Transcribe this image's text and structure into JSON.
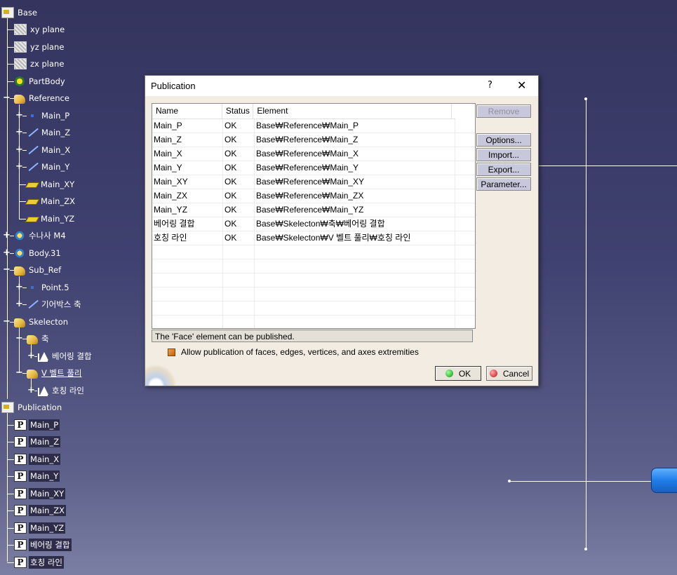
{
  "tree": {
    "root": "Base",
    "items": [
      {
        "label": "xy plane"
      },
      {
        "label": "yz plane"
      },
      {
        "label": "zx plane"
      },
      {
        "label": "PartBody"
      },
      {
        "label": "Reference"
      },
      {
        "label": "Main_P"
      },
      {
        "label": "Main_Z"
      },
      {
        "label": "Main_X"
      },
      {
        "label": "Main_Y"
      },
      {
        "label": "Main_XY"
      },
      {
        "label": "Main_ZX"
      },
      {
        "label": "Main_YZ"
      },
      {
        "label": "수나사 M4"
      },
      {
        "label": "Body.31"
      },
      {
        "label": "Sub_Ref"
      },
      {
        "label": "Point.5"
      },
      {
        "label": "기어박스 축"
      },
      {
        "label": "Skelecton"
      },
      {
        "label": "축"
      },
      {
        "label": "베어링 결합"
      },
      {
        "label": "V 벨트 풀리"
      },
      {
        "label": "호칭 라인"
      },
      {
        "label": "Publication"
      },
      {
        "label": "Main_P"
      },
      {
        "label": "Main_Z"
      },
      {
        "label": "Main_X"
      },
      {
        "label": "Main_Y"
      },
      {
        "label": "Main_XY"
      },
      {
        "label": "Main_ZX"
      },
      {
        "label": "Main_YZ"
      },
      {
        "label": "베어링 결합"
      },
      {
        "label": "호칭 라인"
      }
    ]
  },
  "dialog": {
    "title": "Publication",
    "help": "?",
    "close": "✕",
    "columns": [
      "Name",
      "Status",
      "Element"
    ],
    "rows": [
      {
        "name": "Main_P",
        "status": "OK",
        "element": "Base₩Reference₩Main_P"
      },
      {
        "name": "Main_Z",
        "status": "OK",
        "element": "Base₩Reference₩Main_Z"
      },
      {
        "name": "Main_X",
        "status": "OK",
        "element": "Base₩Reference₩Main_X"
      },
      {
        "name": "Main_Y",
        "status": "OK",
        "element": "Base₩Reference₩Main_Y"
      },
      {
        "name": "Main_XY",
        "status": "OK",
        "element": "Base₩Reference₩Main_XY"
      },
      {
        "name": "Main_ZX",
        "status": "OK",
        "element": "Base₩Reference₩Main_ZX"
      },
      {
        "name": "Main_YZ",
        "status": "OK",
        "element": "Base₩Reference₩Main_YZ"
      },
      {
        "name": "베어링 결합",
        "status": "OK",
        "element": "Base₩Skelecton₩축₩베어링 결합"
      },
      {
        "name": "호칭 라인",
        "status": "OK",
        "element": "Base₩Skelecton₩V 벨트 풀리₩호칭 라인"
      }
    ],
    "status_text": "The 'Face' element can be published.",
    "checkbox_label": "Allow publication of faces, edges, vertices, and axes extremities",
    "buttons": {
      "remove": "Remove",
      "options": "Options...",
      "import": "Import...",
      "export": "Export...",
      "parameter": "Parameter...",
      "ok": "OK",
      "cancel": "Cancel"
    }
  }
}
